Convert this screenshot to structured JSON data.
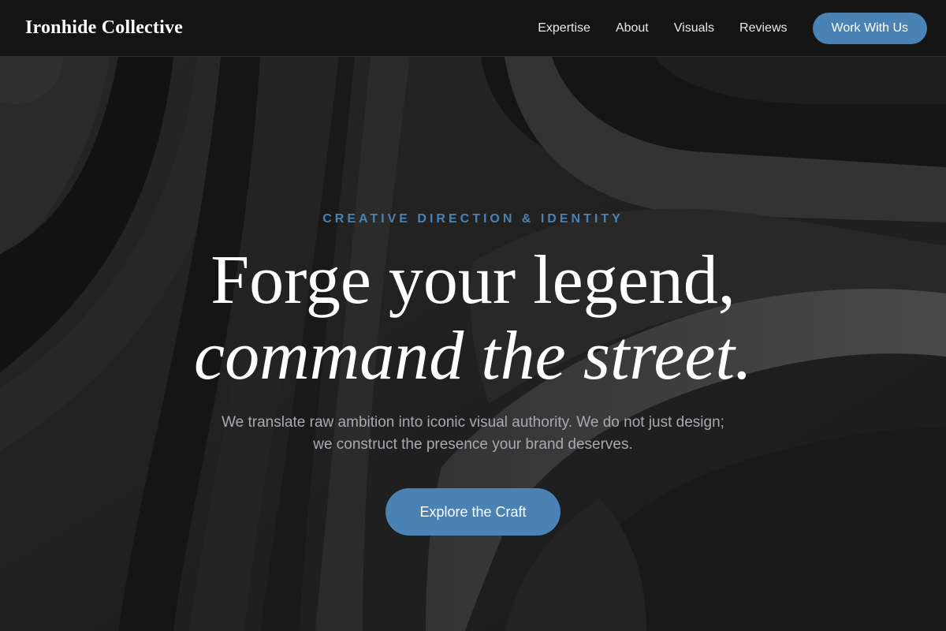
{
  "header": {
    "brand": "Ironhide Collective",
    "nav": [
      {
        "label": "Expertise"
      },
      {
        "label": "About"
      },
      {
        "label": "Visuals"
      },
      {
        "label": "Reviews"
      }
    ],
    "cta_label": "Work With Us"
  },
  "hero": {
    "eyebrow": "CREATIVE DIRECTION & IDENTITY",
    "headline_line1": "Forge your legend,",
    "headline_line2": "command the street.",
    "subtext": "We translate raw ambition into iconic visual authority. We do not just design; we construct the presence your brand deserves.",
    "cta_label": "Explore the Craft"
  },
  "colors": {
    "accent": "#4a82b4",
    "header_bg": "#141414",
    "hero_bg": "#1b1b1b",
    "text_primary": "#ffffff",
    "text_muted": "#a7aab0"
  }
}
